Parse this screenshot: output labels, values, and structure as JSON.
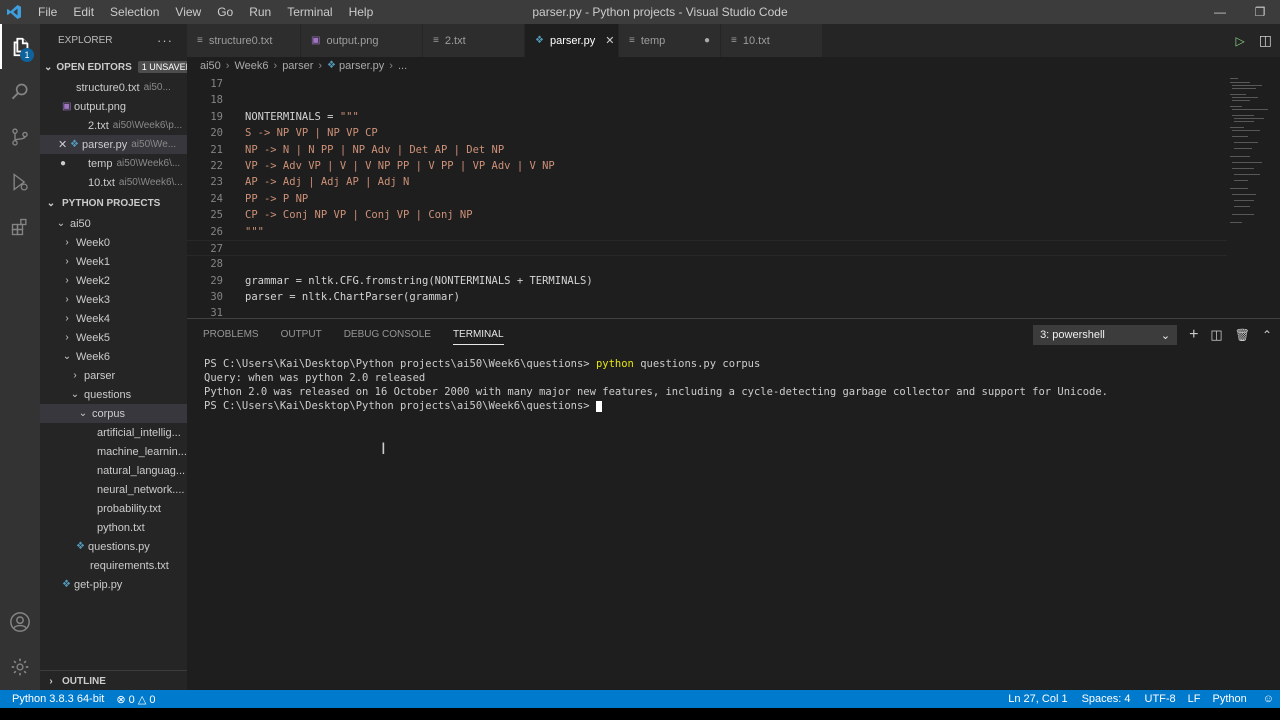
{
  "window": {
    "title": "parser.py - Python projects - Visual Studio Code"
  },
  "menu": [
    "File",
    "Edit",
    "Selection",
    "View",
    "Go",
    "Run",
    "Terminal",
    "Help"
  ],
  "activity": {
    "badge": "1"
  },
  "sidebar": {
    "header": "EXPLORER",
    "open_editors": {
      "label": "OPEN EDITORS",
      "unsaved": "1 UNSAVED",
      "items": [
        {
          "name": "structure0.txt",
          "path": "ai50..."
        },
        {
          "name": "output.png",
          "path": ""
        },
        {
          "name": "2.txt",
          "path": "ai50\\Week6\\p..."
        },
        {
          "name": "parser.py",
          "path": "ai50\\We..."
        },
        {
          "name": "temp",
          "path": "ai50\\Week6\\..."
        },
        {
          "name": "10.txt",
          "path": "ai50\\Week6\\..."
        }
      ]
    },
    "project": {
      "label": "PYTHON PROJECTS",
      "root": "ai50",
      "weeks": [
        "Week0",
        "Week1",
        "Week2",
        "Week3",
        "Week4",
        "Week5",
        "Week6"
      ],
      "parser": "parser",
      "questions": "questions",
      "corpus": "corpus",
      "corpus_files": [
        "artificial_intellig...",
        "machine_learnin...",
        "natural_languag...",
        "neural_network....",
        "probability.txt",
        "python.txt"
      ],
      "questions_py": "questions.py",
      "requirements": "requirements.txt",
      "getpip": "get-pip.py"
    },
    "outline": "OUTLINE"
  },
  "tabs": [
    {
      "label": "structure0.txt"
    },
    {
      "label": "output.png"
    },
    {
      "label": "2.txt"
    },
    {
      "label": "parser.py",
      "close": "✕"
    },
    {
      "label": "temp",
      "close": "●"
    },
    {
      "label": "10.txt"
    }
  ],
  "breadcrumb": [
    "ai50",
    "Week6",
    "parser",
    "parser.py",
    "..."
  ],
  "editor": {
    "lines": [
      {
        "n": "17",
        "text": "",
        "type": "plain"
      },
      {
        "n": "18",
        "text": "",
        "type": "plain"
      },
      {
        "n": "19",
        "text": "NONTERMINALS = \"\"\"",
        "type": "mixed"
      },
      {
        "n": "20",
        "text": "S -> NP VP | NP VP CP",
        "type": "s"
      },
      {
        "n": "21",
        "text": "NP -> N | N PP | NP Adv | Det AP | Det NP",
        "type": "s"
      },
      {
        "n": "22",
        "text": "VP -> Adv VP | V | V NP PP | V PP | VP Adv | V NP",
        "type": "s"
      },
      {
        "n": "23",
        "text": "AP -> Adj | Adj AP | Adj N",
        "type": "s"
      },
      {
        "n": "24",
        "text": "PP -> P NP",
        "type": "s"
      },
      {
        "n": "25",
        "text": "CP -> Conj NP VP | Conj VP | Conj NP",
        "type": "s"
      },
      {
        "n": "26",
        "text": "\"\"\"",
        "type": "s"
      },
      {
        "n": "27",
        "text": "",
        "type": "plain"
      },
      {
        "n": "28",
        "text": "",
        "type": "plain"
      },
      {
        "n": "29",
        "text": "grammar = nltk.CFG.fromstring(NONTERMINALS + TERMINALS)",
        "type": "plain"
      },
      {
        "n": "30",
        "text": "parser = nltk.ChartParser(grammar)",
        "type": "plain"
      },
      {
        "n": "31",
        "text": "",
        "type": "plain"
      }
    ]
  },
  "panel": {
    "tabs": [
      "PROBLEMS",
      "OUTPUT",
      "DEBUG CONSOLE",
      "TERMINAL"
    ],
    "shell": "3: powershell",
    "terminal": {
      "prompt": "PS C:\\Users\\Kai\\Desktop\\Python projects\\ai50\\Week6\\questions> ",
      "command": "python",
      "args": " questions.py corpus",
      "line2": "Query: when was python 2.0 released",
      "line3": "Python 2.0 was released on 16 October 2000 with many major new features, including a cycle-detecting garbage collector and support for Unicode.",
      "prompt2": "PS C:\\Users\\Kai\\Desktop\\Python projects\\ai50\\Week6\\questions> "
    }
  },
  "status": {
    "interpreter": "Python 3.8.3 64-bit",
    "errors": "0",
    "warnings": "0",
    "position": "Ln 27, Col 1",
    "spaces": "Spaces: 4",
    "encoding": "UTF-8",
    "eol": "LF",
    "language": "Python"
  },
  "colors": {
    "accent": "#007acc",
    "string": "#ce9178",
    "python_icon": "#519aba",
    "command": "#e5e510"
  }
}
